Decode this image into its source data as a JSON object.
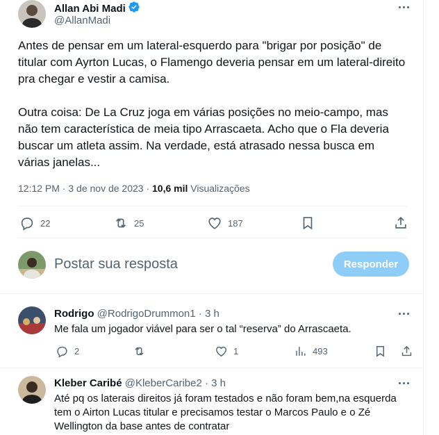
{
  "tweet": {
    "author_name": "Allan Abi Madi",
    "author_handle": "@AllanMadi",
    "text": "Antes de pensar em um lateral-esquerdo para \"brigar por posição\" de titular com Ayrton Lucas, o Flamengo deveria pensar em um lateral-direito pra chegar e vestir a camisa.\n\nOutra coisa: De La Cruz joga em várias posições no meio-campo, mas não tem característica de meia tipo Arrascaeta. Acho que o Fla deveria buscar um atleta assim. Na verdade, está atrasado nessa busca em várias janelas...",
    "time": "12:12 PM · 3 de nov de 2023 · ",
    "views_count": "10,6 mil",
    "views_label": " Visualizações",
    "stats": {
      "replies": "22",
      "retweets": "25",
      "likes": "187"
    }
  },
  "composer": {
    "placeholder": "Postar sua resposta",
    "button_label": "Responder",
    "button_color": "#8ecdf8"
  },
  "replies": [
    {
      "name": "Rodrigo",
      "handle": "@RodrigoDrummon1",
      "time": " · 3 h",
      "text": "Me fala um jogador viável para ser o tal “reserva” do Arrascaeta.",
      "stats": {
        "replies": "2",
        "retweets": "",
        "likes": "1",
        "views": "493"
      }
    },
    {
      "name": "Kleber Caribé",
      "handle": "@KleberCaribe2",
      "time": " · 3 h",
      "text": "Até pq os laterais direitos já foram testados e não foram bem,na esquerda tem o Airton Lucas titular e precisamos testar o Marcos Paulo e o Zé Wellington da base antes de contratar"
    }
  ],
  "colors": {
    "text": "#0f1419",
    "muted": "#536471",
    "verified": "#1d9bf0"
  }
}
